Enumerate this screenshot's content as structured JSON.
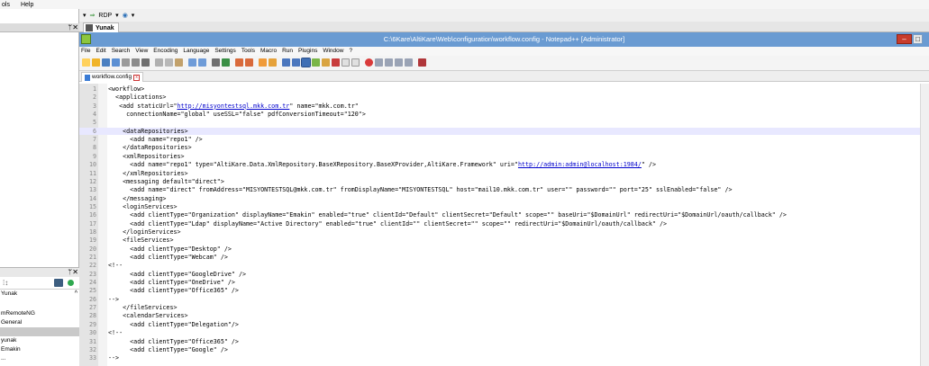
{
  "host_menu": [
    "ols",
    "Help"
  ],
  "rdp_bar": {
    "arrow": "▾",
    "rdp_label": "RDP",
    "globe_arrow": "▾"
  },
  "left_panel": {
    "pin": "ᛘ",
    "close": "✕",
    "lower_pin": "ᛘ",
    "lower_close": "✕",
    "top_row": "Yunak",
    "top_row_mark": "^",
    "items": [
      "mRemoteNG",
      "General",
      "",
      "yunak",
      "Emakin"
    ],
    "bottom_item": "..."
  },
  "host_tab": {
    "label": "Yunak"
  },
  "window": {
    "title": "C:\\6Kare\\AltiKare\\Web\\configuration\\workflow.config - Notepad++ [Administrator]",
    "min_label": "–",
    "max_label": "□"
  },
  "npp_menu": [
    "File",
    "Edit",
    "Search",
    "View",
    "Encoding",
    "Language",
    "Settings",
    "Tools",
    "Macro",
    "Run",
    "Plugins",
    "Window",
    "?"
  ],
  "doc_tab": {
    "label": "workflow.config",
    "close": "x"
  },
  "editor": {
    "current_line": 6,
    "lines": [
      {
        "n": "1",
        "t": "<workflow>"
      },
      {
        "n": "2",
        "t": "  <applications>"
      },
      {
        "n": "3",
        "t": "   <add staticUrl=\"",
        "url": "http://misyontestsql.mkk.com.tr",
        "t2": "\" name=\"mkk.com.tr\""
      },
      {
        "n": "4",
        "t": "     connectionName=\"global\" useSSL=\"false\" pdfConversionTimeout=\"120\">"
      },
      {
        "n": "5",
        "t": ""
      },
      {
        "n": "6",
        "t": "    <dataRepositories>"
      },
      {
        "n": "7",
        "t": "      <add name=\"repo1\" />"
      },
      {
        "n": "8",
        "t": "    </dataRepositories>"
      },
      {
        "n": "9",
        "t": "    <xmlRepositories>"
      },
      {
        "n": "10",
        "t": "      <add name=\"repo1\" type=\"AltiKare.Data.XmlRepository.BaseXRepository.BaseXProvider,AltiKare.Framework\" uri=\"",
        "url": "http://admin:admin@localhost:1984/",
        "t2": "\" />"
      },
      {
        "n": "11",
        "t": "    </xmlRepositories>"
      },
      {
        "n": "12",
        "t": "    <messaging default=\"direct\">"
      },
      {
        "n": "13",
        "t": "      <add name=\"direct\" fromAddress=\"MISYONTESTSQL@mkk.com.tr\" fromDisplayName=\"MISYONTESTSQL\" host=\"mail10.mkk.com.tr\" user=\"\" password=\"\" port=\"25\" sslEnabled=\"false\" />"
      },
      {
        "n": "14",
        "t": "    </messaging>"
      },
      {
        "n": "15",
        "t": "    <loginServices>"
      },
      {
        "n": "16",
        "t": "      <add clientType=\"Organization\" displayName=\"Emakin\" enabled=\"true\" clientId=\"Default\" clientSecret=\"Default\" scope=\"\" baseUri=\"$DomainUrl\" redirectUri=\"$DomainUrl/oauth/callback\" />"
      },
      {
        "n": "17",
        "t": "      <add clientType=\"Ldap\" displayName=\"Active Directory\" enabled=\"true\" clientId=\"\" clientSecret=\"\" scope=\"\" redirectUri=\"$DomainUrl/oauth/callback\" />"
      },
      {
        "n": "18",
        "t": "    </loginServices>"
      },
      {
        "n": "19",
        "t": "    <fileServices>"
      },
      {
        "n": "20",
        "t": "      <add clientType=\"Desktop\" />"
      },
      {
        "n": "21",
        "t": "      <add clientType=\"Webcam\" />"
      },
      {
        "n": "22",
        "t": "<!--"
      },
      {
        "n": "23",
        "t": "      <add clientType=\"GoogleDrive\" />"
      },
      {
        "n": "24",
        "t": "      <add clientType=\"OneDrive\" />"
      },
      {
        "n": "25",
        "t": "      <add clientType=\"Office365\" />"
      },
      {
        "n": "26",
        "t": "-->"
      },
      {
        "n": "27",
        "t": "    </fileServices>"
      },
      {
        "n": "28",
        "t": "    <calendarServices>"
      },
      {
        "n": "29",
        "t": "      <add clientType=\"Delegation\"/>"
      },
      {
        "n": "30",
        "t": "<!--"
      },
      {
        "n": "31",
        "t": "      <add clientType=\"Office365\" />"
      },
      {
        "n": "32",
        "t": "      <add clientType=\"Google\" />"
      },
      {
        "n": "33",
        "t": "-->"
      }
    ]
  }
}
